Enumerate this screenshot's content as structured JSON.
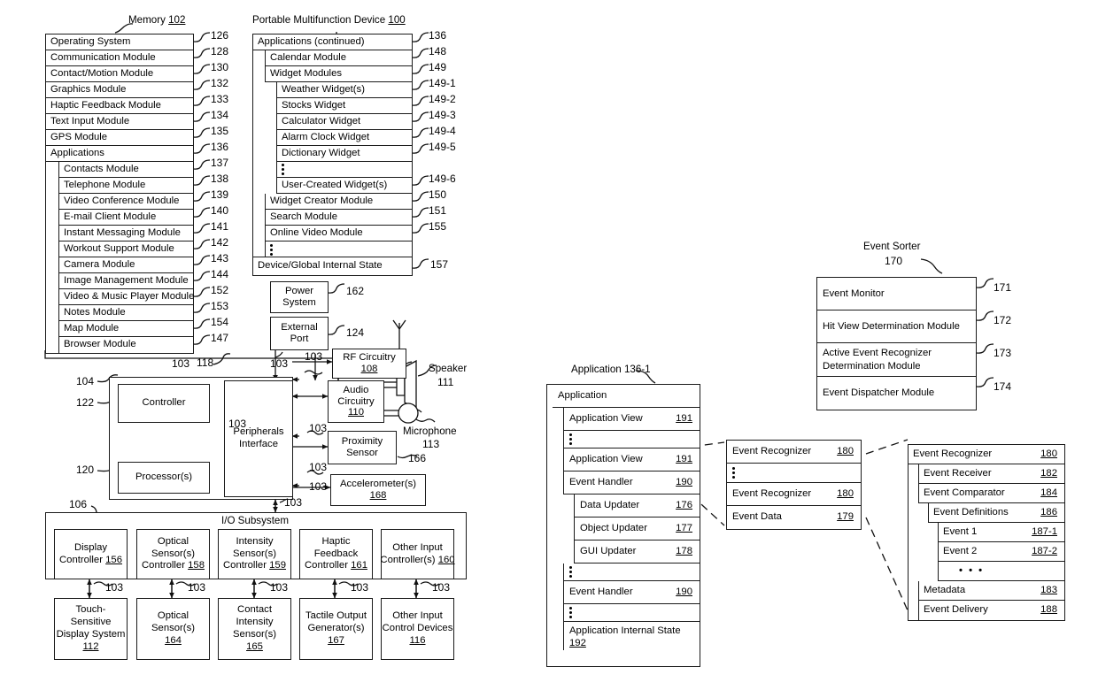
{
  "figure": {
    "memory_caption": "Memory",
    "memory_ref": "102",
    "device_caption": "Portable Multifunction Device",
    "device_ref": "100",
    "event_sorter_caption": "Event Sorter",
    "event_sorter_ref": "170",
    "application_caption": "Application 136-1",
    "io_subsystem_label": "I/O Subsystem"
  },
  "memory_list": [
    {
      "label": "Operating System",
      "ref": "126",
      "indent": 0
    },
    {
      "label": "Communication Module",
      "ref": "128",
      "indent": 0
    },
    {
      "label": "Contact/Motion Module",
      "ref": "130",
      "indent": 0
    },
    {
      "label": "Graphics Module",
      "ref": "132",
      "indent": 0
    },
    {
      "label": "Haptic Feedback Module",
      "ref": "133",
      "indent": 0
    },
    {
      "label": "Text Input Module",
      "ref": "134",
      "indent": 0
    },
    {
      "label": "GPS Module",
      "ref": "135",
      "indent": 0
    },
    {
      "label": "Applications",
      "ref": "136",
      "indent": 0
    },
    {
      "label": "Contacts Module",
      "ref": "137",
      "indent": 1
    },
    {
      "label": "Telephone Module",
      "ref": "138",
      "indent": 1
    },
    {
      "label": "Video Conference Module",
      "ref": "139",
      "indent": 1
    },
    {
      "label": "E-mail Client Module",
      "ref": "140",
      "indent": 1
    },
    {
      "label": "Instant Messaging Module",
      "ref": "141",
      "indent": 1
    },
    {
      "label": "Workout Support Module",
      "ref": "142",
      "indent": 1
    },
    {
      "label": "Camera Module",
      "ref": "143",
      "indent": 1
    },
    {
      "label": "Image Management Module",
      "ref": "144",
      "indent": 1
    },
    {
      "label": "Video & Music Player Module",
      "ref": "152",
      "indent": 1
    },
    {
      "label": "Notes Module",
      "ref": "153",
      "indent": 1
    },
    {
      "label": "Map Module",
      "ref": "154",
      "indent": 1
    },
    {
      "label": "Browser Module",
      "ref": "147",
      "indent": 1
    }
  ],
  "applications_cont": [
    {
      "label": "Applications (continued)",
      "ref": "136",
      "indent": 0,
      "dots": false
    },
    {
      "label": "Calendar Module",
      "ref": "148",
      "indent": 1,
      "dots": false
    },
    {
      "label": "Widget Modules",
      "ref": "149",
      "indent": 1,
      "dots": false
    },
    {
      "label": "Weather Widget(s)",
      "ref": "149-1",
      "indent": 2,
      "dots": false
    },
    {
      "label": "Stocks Widget",
      "ref": "149-2",
      "indent": 2,
      "dots": false
    },
    {
      "label": "Calculator Widget",
      "ref": "149-3",
      "indent": 2,
      "dots": false
    },
    {
      "label": "Alarm Clock Widget",
      "ref": "149-4",
      "indent": 2,
      "dots": false
    },
    {
      "label": "Dictionary Widget",
      "ref": "149-5",
      "indent": 2,
      "dots": false
    },
    {
      "label": "",
      "ref": "",
      "indent": 2,
      "dots": true
    },
    {
      "label": "User-Created Widget(s)",
      "ref": "149-6",
      "indent": 2,
      "dots": false
    },
    {
      "label": "Widget Creator Module",
      "ref": "150",
      "indent": 1,
      "dots": false
    },
    {
      "label": "Search Module",
      "ref": "151",
      "indent": 1,
      "dots": false
    },
    {
      "label": "Online Video Module",
      "ref": "155",
      "indent": 1,
      "dots": false
    },
    {
      "label": "",
      "ref": "",
      "indent": 1,
      "dots": true
    }
  ],
  "device_state": {
    "label": "Device/Global Internal State",
    "ref": "157"
  },
  "hardware": {
    "power_system": {
      "label": "Power System",
      "ref": "162"
    },
    "external_port": {
      "label": "External Port",
      "ref": "124"
    },
    "rf_circuitry": {
      "label": "RF Circuitry",
      "ref": "108"
    },
    "audio_circuitry": {
      "label": "Audio Circuitry",
      "ref": "110"
    },
    "proximity_sensor": {
      "label": "Proximity Sensor",
      "ref": "166"
    },
    "accelerometers": {
      "label": "Accelerometer(s)",
      "ref": "168"
    },
    "speaker": {
      "label": "Speaker",
      "ref": "111"
    },
    "microphone": {
      "label": "Microphone",
      "ref": "113"
    },
    "controller": {
      "label": "Controller",
      "ref": "122"
    },
    "processors": {
      "label": "Processor(s)",
      "ref": "120"
    },
    "peripherals_interface": {
      "label": "Peripherals Interface",
      "ref": "118"
    },
    "cpu_group_ref": "104",
    "io_group_ref": "106",
    "bus_ref": "103"
  },
  "io_controllers": [
    {
      "lines": [
        "Display",
        "Controller"
      ],
      "ref": "156"
    },
    {
      "lines": [
        "Optical",
        "Sensor(s)",
        "Controller"
      ],
      "ref": "158"
    },
    {
      "lines": [
        "Intensity",
        "Sensor(s)",
        "Controller"
      ],
      "ref": "159"
    },
    {
      "lines": [
        "Haptic",
        "Feedback",
        "Controller"
      ],
      "ref": "161"
    },
    {
      "lines": [
        "Other Input",
        "Controller(s)"
      ],
      "ref": "160"
    }
  ],
  "io_devices": [
    {
      "lines": [
        "Touch-",
        "Sensitive",
        "Display System"
      ],
      "ref": "112"
    },
    {
      "lines": [
        "Optical",
        "Sensor(s)"
      ],
      "ref": "164"
    },
    {
      "lines": [
        "Contact",
        "Intensity",
        "Sensor(s)"
      ],
      "ref": "165"
    },
    {
      "lines": [
        "Tactile Output",
        "Generator(s)"
      ],
      "ref": "167"
    },
    {
      "lines": [
        "Other Input",
        "Control Devices"
      ],
      "ref": "116"
    }
  ],
  "event_sorter": [
    {
      "label": "Event Monitor",
      "ref": "171"
    },
    {
      "label": "Hit View Determination Module",
      "ref": "172"
    },
    {
      "label": "Active Event Recognizer Determination Module",
      "ref": "173"
    },
    {
      "label": "Event Dispatcher Module",
      "ref": "174"
    }
  ],
  "application_block": [
    {
      "label": "Application",
      "ref": "",
      "indent": 0,
      "dots": false
    },
    {
      "label": "Application View",
      "ref": "191",
      "indent": 1,
      "dots": false
    },
    {
      "label": "",
      "ref": "",
      "indent": 1,
      "dots": true
    },
    {
      "label": "Application View",
      "ref": "191",
      "indent": 1,
      "dots": false
    },
    {
      "label": "Event Handler",
      "ref": "190",
      "indent": 1,
      "dots": false
    },
    {
      "label": "Data Updater",
      "ref": "176",
      "indent": 2,
      "dots": false
    },
    {
      "label": "Object Updater",
      "ref": "177",
      "indent": 2,
      "dots": false
    },
    {
      "label": "GUI Updater",
      "ref": "178",
      "indent": 2,
      "dots": false
    },
    {
      "label": "",
      "ref": "",
      "indent": 1,
      "dots": true
    },
    {
      "label": "Event Handler",
      "ref": "190",
      "indent": 1,
      "dots": false
    },
    {
      "label": "",
      "ref": "",
      "indent": 1,
      "dots": true
    },
    {
      "label": "Application Internal State",
      "ref": "192",
      "indent": 1,
      "dots": false,
      "wrap": true
    }
  ],
  "event_recognizer_list": [
    {
      "label": "Event Recognizer",
      "ref": "180",
      "dots": false
    },
    {
      "label": "",
      "ref": "",
      "dots": true
    },
    {
      "label": "Event Recognizer",
      "ref": "180",
      "dots": false
    },
    {
      "label": "Event Data",
      "ref": "179",
      "dots": false
    }
  ],
  "event_recognizer_detail": [
    {
      "label": "Event Recognizer",
      "ref": "180",
      "indent": 0,
      "ellipsis": false
    },
    {
      "label": "Event Receiver",
      "ref": "182",
      "indent": 1,
      "ellipsis": false
    },
    {
      "label": "Event Comparator",
      "ref": "184",
      "indent": 1,
      "ellipsis": false
    },
    {
      "label": "Event Definitions",
      "ref": "186",
      "indent": 2,
      "ellipsis": false
    },
    {
      "label": "Event 1",
      "ref": "187-1",
      "indent": 3,
      "ellipsis": false
    },
    {
      "label": "Event 2",
      "ref": "187-2",
      "indent": 3,
      "ellipsis": false
    },
    {
      "label": "",
      "ref": "",
      "indent": 3,
      "ellipsis": true
    },
    {
      "label": "Metadata",
      "ref": "183",
      "indent": 1,
      "ellipsis": false
    },
    {
      "label": "Event Delivery",
      "ref": "188",
      "indent": 1,
      "ellipsis": false
    }
  ],
  "bus_labels": {
    "b1": "103",
    "b2": "103",
    "b3": "103",
    "b4": "103",
    "b5": "103",
    "b6": "103",
    "b7": "103",
    "b8": "103",
    "b9": "103",
    "b10": "103",
    "b11": "103",
    "b12": "103",
    "b13": "103",
    "b14": "103",
    "b15": "103"
  }
}
